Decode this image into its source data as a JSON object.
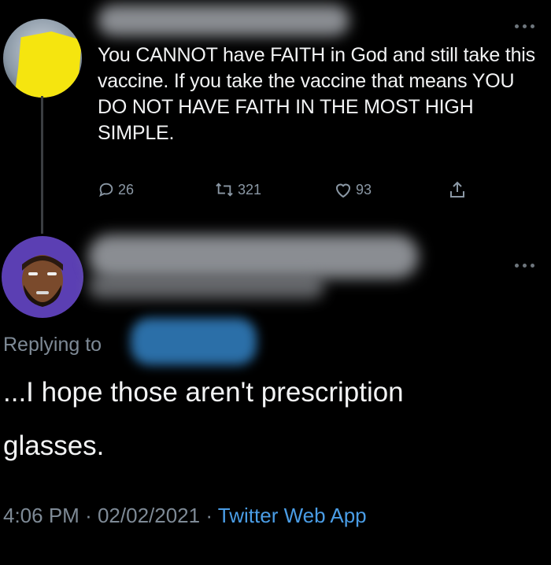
{
  "tweet": {
    "text": "You CANNOT have FAITH in God and still take this vaccine. If you take the vaccine that means YOU DO NOT HAVE FAITH IN THE MOST HIGH SIMPLE.",
    "replies": "26",
    "retweets": "321",
    "likes": "93",
    "icons": [
      "reply-icon",
      "retweet-icon",
      "like-icon",
      "share-icon",
      "more-icon"
    ]
  },
  "reply": {
    "replying_to_label": "Replying to",
    "text_line1": "...I hope those aren't prescription",
    "text_line2": "glasses.",
    "time": "4:06 PM",
    "separator": "·",
    "date": "02/02/2021",
    "source": "Twitter Web App"
  },
  "colors": {
    "background": "#000000",
    "text": "#f2f3f4",
    "muted": "#7e8a96",
    "link": "#4a9de6",
    "redaction_yellow": "#f5e50f",
    "avatar_purple": "#5b3fb3"
  }
}
